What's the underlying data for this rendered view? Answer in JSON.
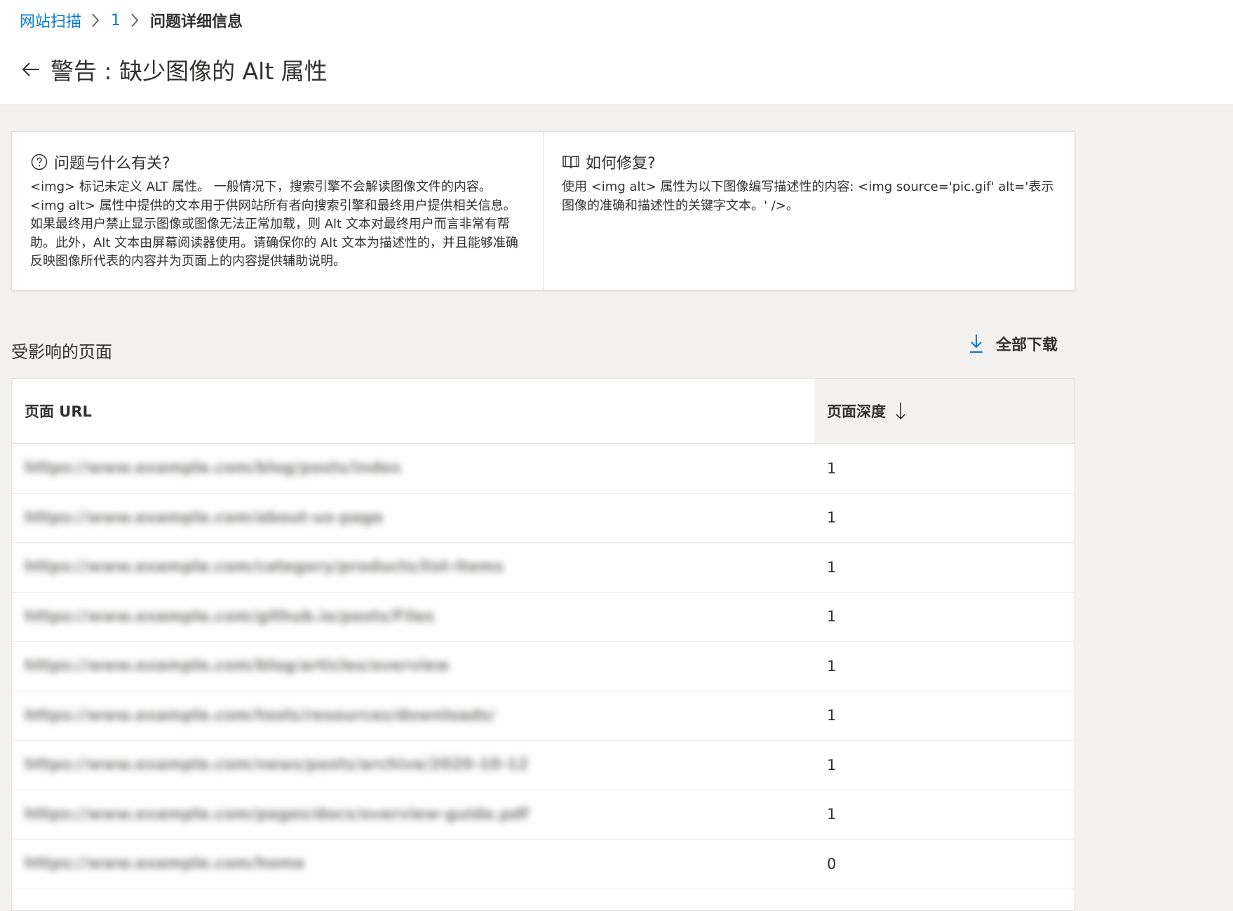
{
  "breadcrumb": {
    "items": [
      "网站扫描",
      "1"
    ],
    "current": "问题详细信息"
  },
  "title": "警告 : 缺少图像的 Alt 属性",
  "info": {
    "what": {
      "icon": "question-circle-icon",
      "heading": "问题与什么有关?",
      "body": "<img> 标记未定义 ALT 属性。 一般情况下，搜索引擎不会解读图像文件的内容。<img alt> 属性中提供的文本用于供网站所有者向搜索引擎和最终用户提供相关信息。如果最终用户禁止显示图像或图像无法正常加载，则 Alt 文本对最终用户而言非常有帮助。此外，Alt 文本由屏幕阅读器使用。请确保你的 Alt 文本为描述性的，并且能够准确反映图像所代表的内容并为页面上的内容提供辅助说明。"
    },
    "fix": {
      "icon": "book-icon",
      "heading": "如何修复?",
      "body": "使用 <img alt> 属性为以下图像编写描述性的内容: <img source='pic.gif' alt='表示图像的准确和描述性的关键字文本。' />。"
    }
  },
  "affected": {
    "title": "受影响的页面",
    "download_label": "全部下载",
    "columns": {
      "url": "页面 URL",
      "depth": "页面深度"
    },
    "rows": [
      {
        "url": "https://www.example.com/blog/posts/index",
        "depth": "1"
      },
      {
        "url": "https://www.example.com/about-us-page",
        "depth": "1"
      },
      {
        "url": "https://www.example.com/category/products/list-items",
        "depth": "1"
      },
      {
        "url": "https://www.example.com/github.io/posts/Files",
        "depth": "1"
      },
      {
        "url": "https://www.example.com/blog/articles/overview",
        "depth": "1"
      },
      {
        "url": "https://www.example.com/tools/resources/downloads/",
        "depth": "1"
      },
      {
        "url": "https://www.example.com/news/posts/archive/2020-10-12",
        "depth": "1"
      },
      {
        "url": "https://www.example.com/pages/docs/overview-guide.pdf",
        "depth": "1"
      },
      {
        "url": "https://www.example.com/home",
        "depth": "0"
      }
    ]
  }
}
